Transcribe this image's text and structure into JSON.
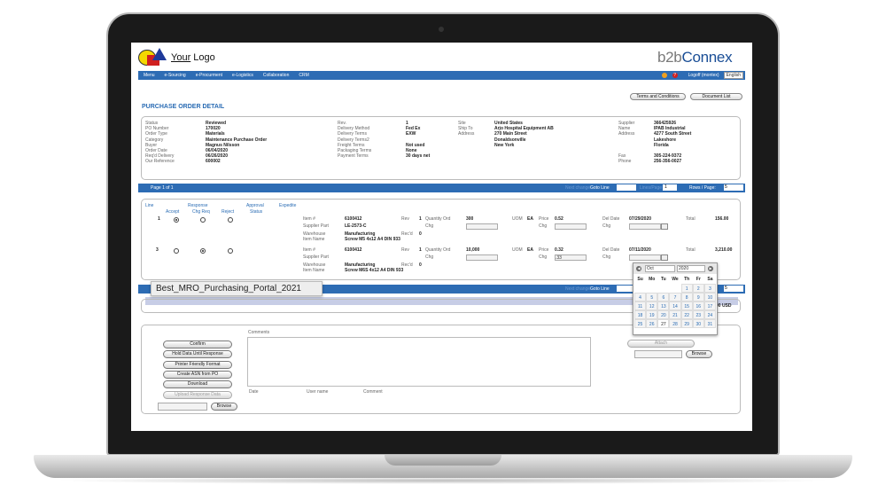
{
  "logo": {
    "your": "Your",
    "logo": "Logo"
  },
  "brand": {
    "b2b": "b2b",
    "connex": "Connex"
  },
  "nav": {
    "items": [
      "Menu",
      "e-Sourcing",
      "e-Procurment",
      "e-Logistics",
      "Collaboration",
      "CRM"
    ],
    "logoff": "Logoff (montex)",
    "lang": "English"
  },
  "buttons": {
    "terms": "Terms and Conditions",
    "doclist": "Document List"
  },
  "page_title": "PURCHASE ORDER DETAIL",
  "header": {
    "col1": [
      [
        "Status",
        "Reviewed"
      ],
      [
        "PO Number",
        "170020"
      ],
      [
        "Order Type",
        "Materials"
      ],
      [
        "Category",
        "Maintenance Purchase Order"
      ],
      [
        "Buyer",
        "Magnus Nilsson"
      ],
      [
        "Order Date",
        "06/04/2020"
      ],
      [
        "Req'd Delivery",
        "06/26/2020"
      ],
      [
        "Our Reference",
        "600002"
      ]
    ],
    "col2": [
      [
        "Rev.",
        "1"
      ],
      [
        "Delivery Method",
        "Fed Ex"
      ],
      [
        "Delivery Terms",
        "EXW"
      ],
      [
        "Delivery Terms2",
        ""
      ],
      [
        "Freight Terms",
        "Not used"
      ],
      [
        "Packaging Terms",
        "None"
      ],
      [
        "Payment Terms",
        "30 days net"
      ]
    ],
    "col3": [
      [
        "Site",
        "United States"
      ],
      [
        "Ship To",
        "Arjo Hospital Equipment AB"
      ],
      [
        "Address",
        "270 Main Street"
      ],
      [
        "",
        "Donaldsonville"
      ],
      [
        "",
        "New York"
      ]
    ],
    "col4": [
      [
        "Supplier",
        "366425926"
      ],
      [
        "Name",
        "IPAB Industrial"
      ],
      [
        "Address",
        "4277 South Street"
      ],
      [
        "",
        "Lakeshore"
      ],
      [
        "",
        "Florida"
      ],
      [
        "",
        ""
      ],
      [
        "Fax",
        "305-224-9372"
      ],
      [
        "Phone",
        "256-356-0027"
      ]
    ]
  },
  "pager": {
    "page": "Page 1 of 1",
    "next_change": "Next change",
    "goto": "Goto Line",
    "page_size": "Lines/Page",
    "page_val": "1",
    "rows": "Rows / Page:",
    "rows_val": "5"
  },
  "cols": {
    "line": "Line",
    "response": "Response",
    "accept": "Accept",
    "chgreq": "Chg Req",
    "reject": "Reject",
    "approval": "Approval",
    "status": "Status",
    "expedite": "Expedite"
  },
  "rows": [
    {
      "line": "1",
      "item_k": "Item #",
      "item": "6100412",
      "rev_k": "Rev",
      "rev": "1",
      "qty_k": "Quantity Ord",
      "qty": "300",
      "chg": "Chg",
      "uom_k": "UOM",
      "uom": "EA",
      "price_k": "Price",
      "price": "0.52",
      "del_k": "Del Date",
      "del": "07/29/2020",
      "tot_k": "Total",
      "tot": "156.00",
      "sp_k": "Supplier Part",
      "sp": "LE-2573-C",
      "wh_k": "Warehouse",
      "wh": "Manufacturing",
      "rcvd_k": "Rec'd",
      "rcvd": "0",
      "in_k": "Item Name",
      "in": "Screw M5 4x12 A4 DIN 933"
    },
    {
      "line": "3",
      "item_k": "Item #",
      "item": "6100412",
      "rev_k": "Rev",
      "rev": "1",
      "qty_k": "Quantity Ord",
      "qty": "10,000",
      "chg": "Chg",
      "uom_k": "UOM",
      "uom": "EA",
      "price_k": "Price",
      "price": "0.32",
      "price_chg": ".33",
      "del_k": "Del Date",
      "del": "07/11/2020",
      "tot_k": "Total",
      "tot": "3,210.00",
      "sp_k": "Supplier Part",
      "sp": "",
      "wh_k": "Warehouse",
      "wh": "Manufacturing",
      "rcvd_k": "Rec'd",
      "rcvd": "0",
      "in_k": "Item Name",
      "in": "Screw M6S 4x12 A4 DIN 933"
    }
  ],
  "calendar": {
    "month": "Oct",
    "year": "2020",
    "days": [
      "Su",
      "Mo",
      "Tu",
      "We",
      "Th",
      "Fr",
      "Sa"
    ],
    "dates": [
      "",
      "",
      "",
      "",
      "1",
      "2",
      "3",
      "4",
      "5",
      "6",
      "7",
      "8",
      "9",
      "10",
      "11",
      "12",
      "13",
      "14",
      "15",
      "16",
      "17",
      "18",
      "19",
      "20",
      "21",
      "22",
      "23",
      "24",
      "25",
      "26",
      "27",
      "28",
      "29",
      "30",
      "31"
    ],
    "current": "27"
  },
  "tooltip": "Best_MRO_Purchasing_Portal_2021",
  "total_usd": "00 USD",
  "actions": {
    "buttons": [
      "Confirm",
      "Hold Data Until Response",
      "Printer Friendly Format",
      "Create ASN from PO",
      "Download",
      "Upload Response Data"
    ],
    "comments": "Comments",
    "date": "Date",
    "user": "User name",
    "comment": "Comment",
    "attach": "Attach",
    "browse": "Browse"
  }
}
